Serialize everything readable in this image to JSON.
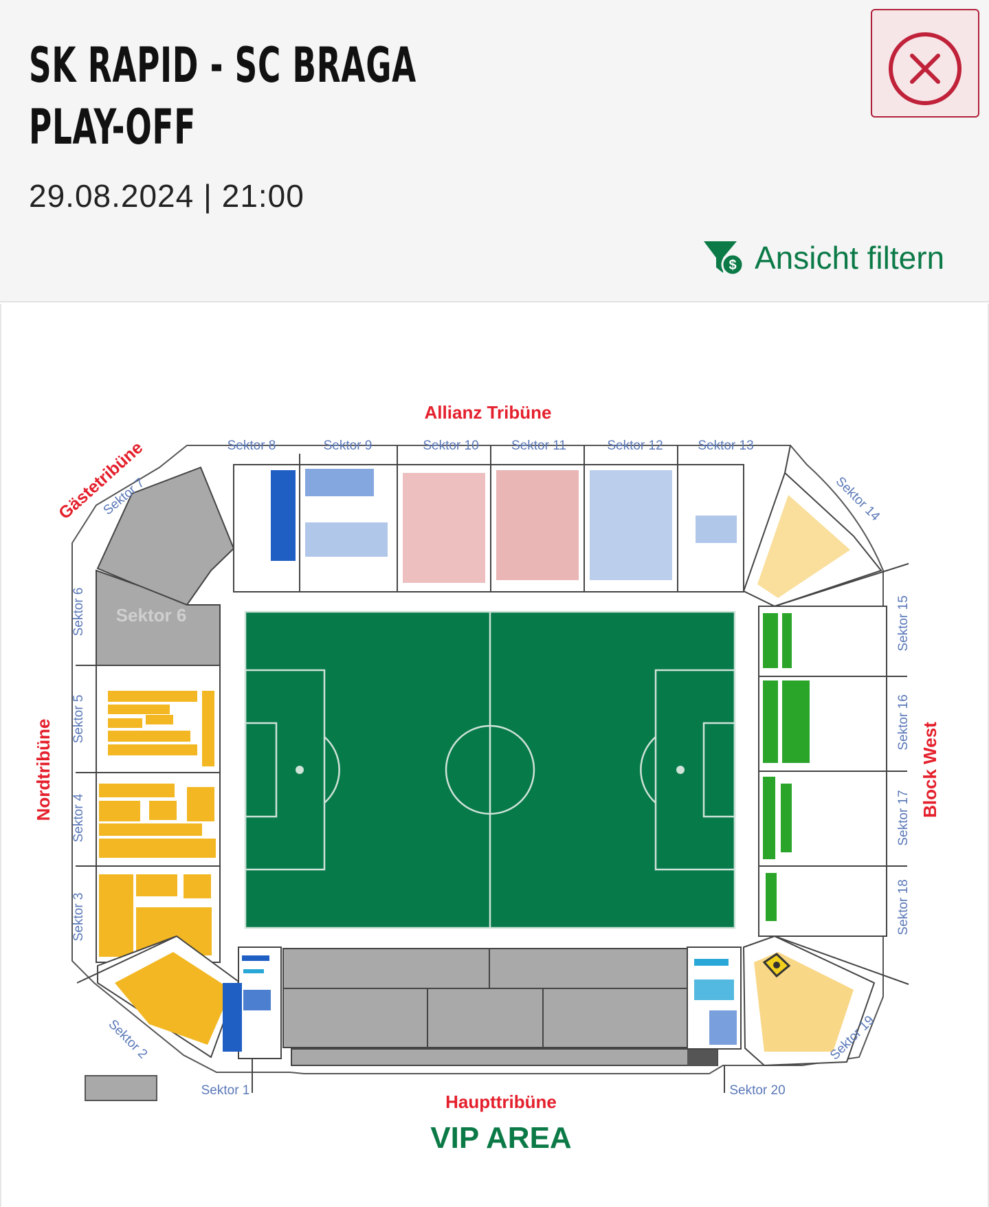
{
  "event": {
    "title_line1": "SK RAPID - SC BRAGA",
    "title_line2": "PLAY-OFF",
    "datetime": "29.08.2024 | 21:00"
  },
  "toolbar": {
    "filter_label": "Ansicht filtern",
    "filter_icon": "filter-dollar-icon",
    "close_icon": "close-circle-icon"
  },
  "stadium": {
    "stands": {
      "top": "Allianz Tribüne",
      "away": "Gästetribüne",
      "north": "Nordtribüne",
      "west": "Block West",
      "main": "Haupttribüne",
      "vip": "VIP AREA"
    },
    "sectors": {
      "s1": "Sektor 1",
      "s2": "Sektor 2",
      "s3": "Sektor 3",
      "s4": "Sektor 4",
      "s5": "Sektor 5",
      "s6": "Sektor 6",
      "s6_field": "Sektor 6",
      "s7": "Sektor 7",
      "s8": "Sektor 8",
      "s9": "Sektor 9",
      "s10": "Sektor 10",
      "s11": "Sektor 11",
      "s12": "Sektor 12",
      "s13": "Sektor 13",
      "s14": "Sektor 14",
      "s15": "Sektor 15",
      "s16": "Sektor 16",
      "s17": "Sektor 17",
      "s18": "Sektor 18",
      "s19": "Sektor 19",
      "s20": "Sektor 20"
    }
  },
  "colors": {
    "pitch": "#077a4a",
    "stand_label": "#e4202c",
    "vip": "#0b7a47",
    "sector_label": "#5a78b8",
    "seat_blue": "#1f5fc4",
    "seat_red": "#c42a2a",
    "seat_yellow": "#f2b722",
    "seat_green": "#2aa52a",
    "seat_cyan": "#29a8d8",
    "blocked": "#a9a9a9"
  }
}
